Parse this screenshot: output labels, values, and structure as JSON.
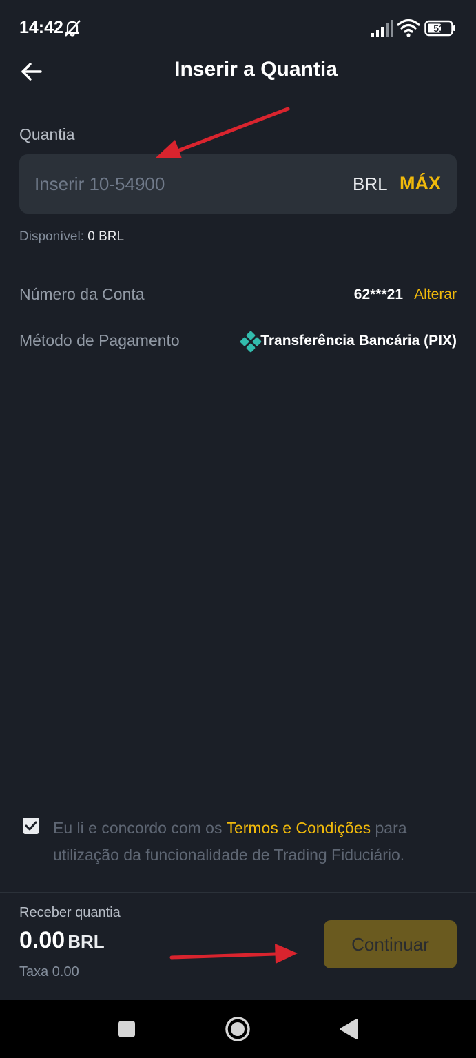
{
  "status_bar": {
    "time": "14:42",
    "battery": "51"
  },
  "header": {
    "title": "Inserir a Quantia"
  },
  "amount": {
    "label": "Quantia",
    "placeholder": "Inserir 10-54900",
    "currency": "BRL",
    "max_label": "MÁX",
    "available_label": "Disponível:",
    "available_value": "0 BRL"
  },
  "account": {
    "label": "Número da Conta",
    "value": "62***21",
    "change_label": "Alterar"
  },
  "payment": {
    "label": "Método de Pagamento",
    "value": "Transferência Bancária (PIX)",
    "icon": "pix-icon"
  },
  "terms": {
    "checked": true,
    "before": "Eu li e concordo com os ",
    "link": "Termos e Condições",
    "after": " para utilização da funcionalidade de Trading Fiduciário."
  },
  "footer": {
    "receive_label": "Receber quantia",
    "receive_amount": "0.00",
    "receive_currency": "BRL",
    "fee_text": "Taxa 0.00",
    "continue_label": "Continuar"
  },
  "colors": {
    "accent": "#f0b90b",
    "background": "#1b1f27",
    "field": "#2b3139",
    "annotation": "#d9242e"
  }
}
